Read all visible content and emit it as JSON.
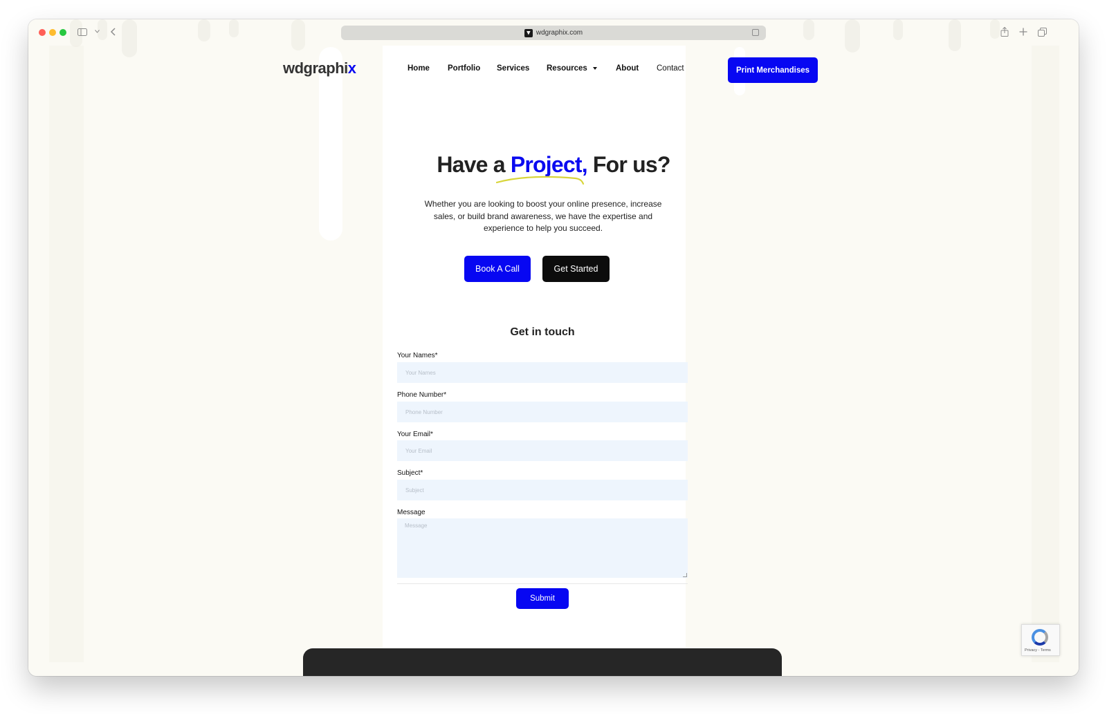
{
  "browser": {
    "url": "wdgraphix.com"
  },
  "site": {
    "logo_main": "wdgraphi",
    "logo_accent": "x",
    "nav": {
      "home": "Home",
      "portfolio": "Portfolio",
      "services": "Services",
      "resources": "Resources",
      "about": "About",
      "contact": "Contact"
    },
    "cta_label": "Print Merchandises"
  },
  "hero": {
    "title_before": "Have a ",
    "title_accent": "Project,",
    "title_after": " For us?",
    "subtitle": "Whether you are looking to boost your online presence, increase sales, or build brand awareness, we have the expertise and experience to help you succeed.",
    "book_call_label": "Book A Call",
    "get_started_label": "Get Started"
  },
  "form": {
    "title": "Get in touch",
    "names_label": "Your Names*",
    "names_placeholder": "Your Names",
    "phone_label": "Phone Number*",
    "phone_placeholder": "Phone Number",
    "email_label": "Your Email*",
    "email_placeholder": "Your Email",
    "subject_label": "Subject*",
    "subject_placeholder": "Subject",
    "message_label": "Message",
    "message_placeholder": "Message",
    "submit_label": "Submit"
  },
  "recaptcha": {
    "links": "Privacy - Terms"
  },
  "colors": {
    "brand_blue": "#0707f2",
    "page_background": "#fbfaf4",
    "squiggle": "#d8d53a"
  }
}
